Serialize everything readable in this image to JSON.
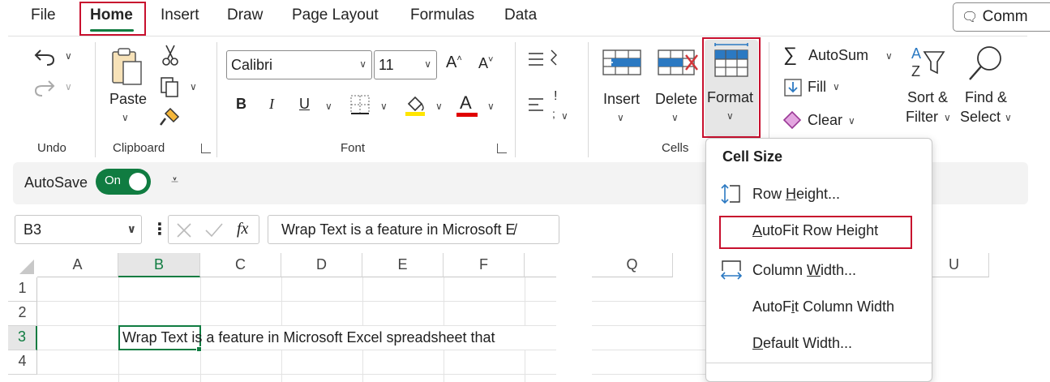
{
  "menu_tabs": [
    "File",
    "Home",
    "Insert",
    "Draw",
    "Page Layout",
    "Formulas",
    "Data"
  ],
  "comments_button": "Comm",
  "ribbon": {
    "undo_group": "Undo",
    "clipboard": {
      "paste": "Paste",
      "group": "Clipboard"
    },
    "font": {
      "name": "Calibri",
      "size": "11",
      "bold": "B",
      "italic": "I",
      "underline": "U",
      "grow": "A",
      "shrink": "A",
      "font_color": "A",
      "group": "Font"
    },
    "alignment": {
      "partial_label": "!",
      "partial_label2": ";"
    },
    "cells": {
      "insert": "Insert",
      "delete": "Delete",
      "format": "Format",
      "group": "Cells"
    },
    "editing": {
      "autosum": "AutoSum",
      "fill": "Fill",
      "clear": "Clear",
      "sort_filter_1": "Sort &",
      "sort_filter_2": "Filter",
      "find_1": "Find &",
      "find_2": "Select"
    }
  },
  "quick_access": {
    "autosave": "AutoSave",
    "toggle": "On"
  },
  "formula_bar": {
    "name_box": "B3",
    "fx": "fx",
    "content": "Wrap Text is a feature in Microsoft E̸"
  },
  "grid": {
    "columns": [
      "A",
      "B",
      "C",
      "D",
      "E",
      "F",
      "Q",
      "U"
    ],
    "rows": [
      "1",
      "2",
      "3",
      "4"
    ],
    "cell_b3": "Wrap Text is a feature in Microsoft Excel spreadsheet that"
  },
  "format_menu": {
    "section": "Cell Size",
    "items": [
      {
        "pre": "Row ",
        "key": "H",
        "post": "eight..."
      },
      {
        "pre": "",
        "key": "A",
        "post": "utoFit Row Height"
      },
      {
        "pre": "Column ",
        "key": "W",
        "post": "idth..."
      },
      {
        "pre": "AutoF",
        "key": "i",
        "post": "t Column Width"
      },
      {
        "pre": "",
        "key": "D",
        "post": "efault Width..."
      }
    ]
  },
  "colors": {
    "accent_green": "#107c41",
    "highlight_red": "#c8102e",
    "fill_yellow": "#ffe500",
    "font_red": "#e00000",
    "icon_blue": "#2b79c2"
  }
}
